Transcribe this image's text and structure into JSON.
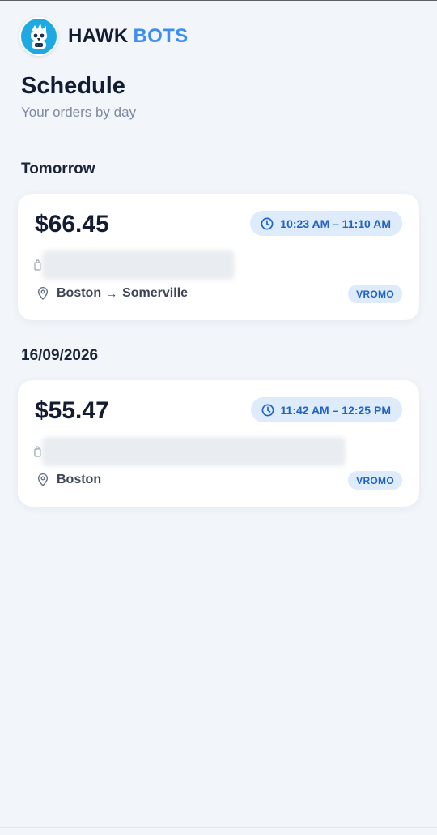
{
  "brand": {
    "name_part1": "HAWK",
    "name_part2": "BOTS",
    "logo_icon": "hawk-robot-logo",
    "accent_color": "#3d8ef2"
  },
  "page": {
    "title": "Schedule",
    "subtitle": "Your orders by day"
  },
  "days": [
    {
      "label": "Tomorrow",
      "orders": [
        {
          "price": "$66.45",
          "time_range": "10:23 AM – 11:10 AM",
          "pickup": "Boston",
          "arrow": "→",
          "dropoff": "Somerville",
          "platform": "VROMO"
        }
      ]
    },
    {
      "label": "16/09/2026",
      "orders": [
        {
          "price": "$55.47",
          "time_range": "11:42 AM – 12:25 PM",
          "pickup": "Boston",
          "platform": "VROMO"
        }
      ]
    }
  ],
  "colors": {
    "background": "#f2f6fb",
    "pill_background": "#deebfb",
    "pill_text": "#1f63c6",
    "text_primary": "#131c33",
    "text_muted": "#7f8aa0"
  }
}
